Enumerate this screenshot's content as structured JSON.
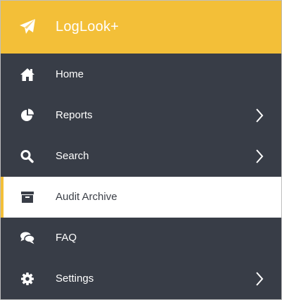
{
  "app": {
    "title": "LogLook+",
    "brand_icon": "paper-plane-icon",
    "accent_color": "#f3bf38",
    "sidebar_color": "#383d47"
  },
  "nav": {
    "items": [
      {
        "label": "Home",
        "icon": "home-icon",
        "has_submenu": false,
        "active": false
      },
      {
        "label": "Reports",
        "icon": "pie-chart-icon",
        "has_submenu": true,
        "active": false
      },
      {
        "label": "Search",
        "icon": "search-icon",
        "has_submenu": true,
        "active": false
      },
      {
        "label": "Audit Archive",
        "icon": "archive-icon",
        "has_submenu": false,
        "active": true
      },
      {
        "label": "FAQ",
        "icon": "comments-icon",
        "has_submenu": false,
        "active": false
      },
      {
        "label": "Settings",
        "icon": "gear-icon",
        "has_submenu": true,
        "active": false
      }
    ]
  }
}
